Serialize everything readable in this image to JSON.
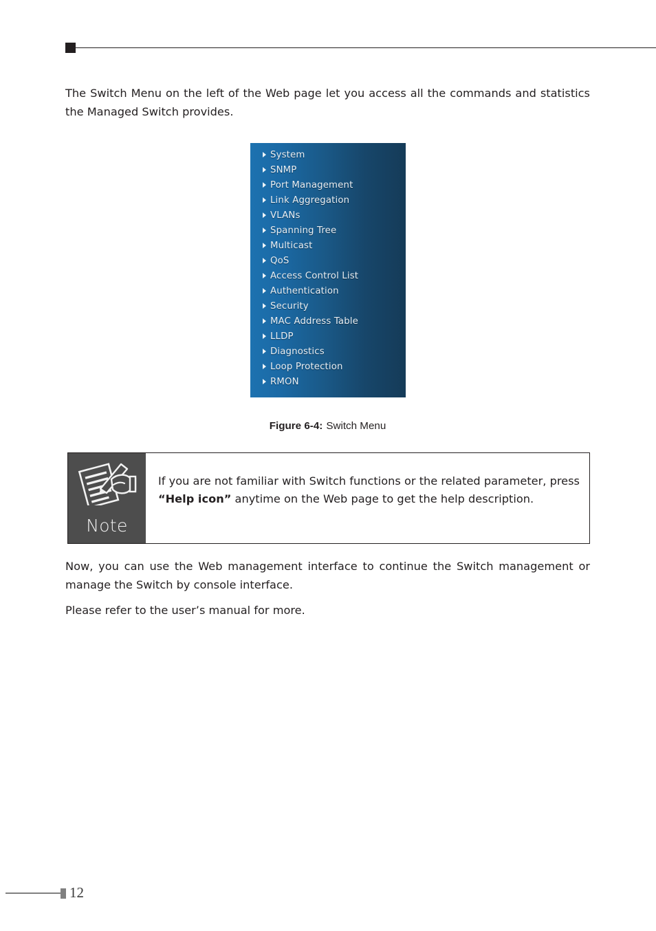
{
  "page": {
    "number": "12"
  },
  "header": {
    "marker_icon": "square-marker-icon"
  },
  "intro": {
    "paragraph": "The Switch Menu on the left of the Web page let you access all the commands and statistics the Managed Switch provides."
  },
  "switch_menu": {
    "title": "Switch Menu",
    "bullet_icon": "triangle-right-icon",
    "items": [
      {
        "label": "System"
      },
      {
        "label": "SNMP"
      },
      {
        "label": "Port Management"
      },
      {
        "label": "Link Aggregation"
      },
      {
        "label": "VLANs"
      },
      {
        "label": "Spanning Tree"
      },
      {
        "label": "Multicast"
      },
      {
        "label": "QoS"
      },
      {
        "label": "Access Control List"
      },
      {
        "label": "Authentication"
      },
      {
        "label": "Security"
      },
      {
        "label": "MAC Address Table"
      },
      {
        "label": "LLDP"
      },
      {
        "label": "Diagnostics"
      },
      {
        "label": "Loop Protection"
      },
      {
        "label": "RMON"
      }
    ],
    "gradient_start": "#1d72b0",
    "gradient_end": "#153b58",
    "text_color": "#e8eff5"
  },
  "figure": {
    "number": "Figure 6-4:",
    "title": "Switch Menu"
  },
  "note": {
    "label": "Note",
    "icon": "notepad-pen-hand-icon",
    "text_before_bold": "If you are not familiar with Switch functions or the related parameter, press ",
    "bold_text": "“Help icon”",
    "text_after_bold": " anytime on the Web page to get the help description.",
    "panel_color": "#4d4d4d",
    "border_color": "#231f20"
  },
  "closing": {
    "paragraph": "Now, you can use the Web management interface to continue the Switch management or manage the Switch by console interface.",
    "manual_note": "Please refer to the user’s manual for more."
  }
}
